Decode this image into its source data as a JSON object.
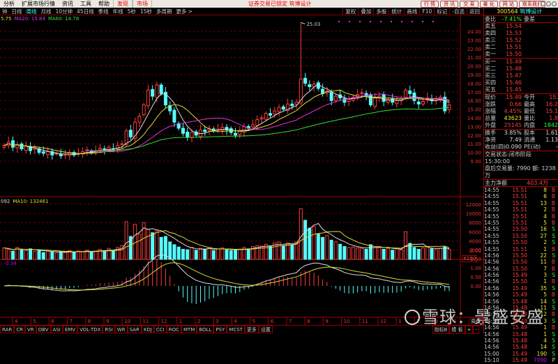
{
  "menu": {
    "items": [
      "分析",
      "扩展市场行情",
      "资讯",
      "工具",
      "帮助"
    ],
    "red_items": [
      "发现",
      "市场"
    ],
    "center": "证券交易已锁定  筑博设计",
    "buttons": [
      "行 情",
      "资 讯",
      "交 易",
      "量 化",
      "网 站",
      "联系我们"
    ]
  },
  "toolbar": {
    "periods": [
      "钟",
      "日线",
      "周线",
      "月线",
      "10分钟",
      "45日线",
      "季线",
      "年线",
      "5秒",
      "15秒",
      "多周期",
      "更多 >"
    ],
    "active": "周线",
    "right": [
      "复权",
      "叠加",
      "多股",
      "统计",
      "画线",
      "F10",
      "标记",
      "-自选",
      "返回"
    ]
  },
  "legends": {
    "price": [
      {
        "text": "5.75",
        "color": "#dddd33"
      },
      {
        "text": "MA20: 15.84",
        "color": "#e030e0"
      },
      {
        "text": "MA60: 14.78",
        "color": "#33dd33"
      }
    ],
    "high_label": "25.03",
    "volume": [
      {
        "text": "092",
        "color": "#ddd"
      },
      {
        "text": "MA10: 132461",
        "color": "#dddd33"
      }
    ],
    "macd": ": -0.34",
    "volume_unit": "X100"
  },
  "axes": {
    "price": [
      "24.00",
      "23.00",
      "22.00",
      "21.00",
      "20.00",
      "19.00",
      "18.00",
      "17.00",
      "16.00",
      "15.00",
      "14.00",
      "13.00",
      "12.00",
      "11.00",
      "10.00",
      "9.00"
    ],
    "volume": [
      "12000",
      "10000",
      "8000",
      "6000",
      "4000",
      "2000"
    ],
    "macd": [
      "2.00",
      "1.50",
      "1.00",
      "0.50",
      "0.00"
    ],
    "months": [
      "4",
      "5",
      "6",
      "7",
      "8",
      "9",
      "10",
      "11",
      "12",
      "1",
      "2",
      "3",
      "4",
      "5",
      "6",
      "7",
      "8",
      "9",
      "10",
      "11",
      "12",
      "1",
      "2",
      "3",
      "4"
    ]
  },
  "chart_data": {
    "type": "candlestick",
    "period": "周线",
    "close": [
      10.8,
      11.2,
      10.6,
      10.9,
      10.4,
      10.7,
      10.2,
      10.5,
      10.0,
      9.9,
      10.1,
      9.7,
      9.9,
      9.6,
      9.8,
      10.0,
      9.7,
      9.9,
      10.1,
      10.3,
      10.0,
      10.2,
      10.5,
      10.3,
      10.6,
      10.4,
      10.8,
      11.0,
      12.5,
      11.8,
      13.5,
      14.2,
      15.5,
      17.2,
      16.5,
      17.8,
      16.8,
      15.5,
      14.8,
      13.5,
      12.8,
      12.2,
      11.8,
      12.3,
      12.0,
      12.6,
      12.4,
      12.8,
      12.5,
      12.7,
      12.9,
      12.6,
      12.3,
      12.0,
      12.5,
      13.0,
      12.8,
      13.2,
      13.8,
      14.0,
      14.5,
      14.3,
      14.8,
      15.2,
      15.0,
      15.6,
      15.4,
      15.8,
      18.5,
      18.0,
      17.6,
      17.9,
      17.4,
      16.8,
      17.1,
      16.0,
      16.5,
      16.3,
      15.8,
      16.2,
      16.4,
      16.7,
      16.9,
      16.6,
      15.5,
      16.3,
      16.5,
      15.9,
      16.1,
      15.8,
      16.0,
      16.2,
      17.2,
      16.8,
      16.0,
      15.6,
      15.9,
      16.3,
      16.0,
      16.2,
      16.4,
      14.8,
      15.49
    ],
    "high_max": 25.03,
    "volume": [
      2500,
      2200,
      1800,
      2600,
      2100,
      1900,
      2300,
      1700,
      2000,
      1500,
      1800,
      1600,
      1400,
      1700,
      1500,
      1900,
      1600,
      1800,
      1700,
      2000,
      1600,
      1800,
      2200,
      1900,
      2400,
      1800,
      2600,
      3000,
      8200,
      5000,
      7600,
      5500,
      8000,
      6500,
      5800,
      6200,
      4800,
      5000,
      3800,
      3200,
      2700,
      2200,
      2100,
      2600,
      2000,
      2400,
      2200,
      2600,
      1900,
      2300,
      2500,
      2100,
      1900,
      2000,
      2200,
      2600,
      2300,
      2800,
      3000,
      2900,
      3300,
      2800,
      3600,
      3800,
      3000,
      3600,
      3200,
      3800,
      11000,
      8500,
      6800,
      7200,
      5500,
      4800,
      5200,
      4200,
      3800,
      3300,
      2800,
      2600,
      2700,
      2500,
      2400,
      2200,
      3200,
      2600,
      2800,
      2200,
      2400,
      2000,
      2300,
      2100,
      6000,
      3500,
      2600,
      2200,
      2500,
      2700,
      2300,
      2100,
      2400,
      2700,
      2200
    ]
  },
  "quote": {
    "code": "300564",
    "name": "筑博设计",
    "weibi_label": "委比",
    "weibi": "-7.41%",
    "weicha_label": "委差",
    "asks": [
      {
        "label": "卖五",
        "price": "15.54"
      },
      {
        "label": "卖四",
        "price": "15.53"
      },
      {
        "label": "卖三",
        "price": "15.52"
      },
      {
        "label": "卖二",
        "price": "15.51"
      },
      {
        "label": "卖一",
        "price": "15.50"
      }
    ],
    "bids": [
      {
        "label": "买一",
        "price": "15.49"
      },
      {
        "label": "买二",
        "price": "15.48"
      },
      {
        "label": "买三",
        "price": "15.47"
      },
      {
        "label": "买四",
        "price": "15.46"
      },
      {
        "label": "买五",
        "price": "15.45"
      }
    ],
    "stats": [
      {
        "l": "现价",
        "v": "15.49",
        "vc": "red",
        "l2": "今开",
        "v2": "15.",
        "v2c": "red"
      },
      {
        "l": "涨跌",
        "v": "0.66",
        "vc": "red",
        "l2": "最高",
        "v2": "16.2",
        "v2c": "red"
      },
      {
        "l": "涨幅",
        "v": "4.45%",
        "vc": "red",
        "l2": "最低",
        "v2": "15.1",
        "v2c": "red"
      },
      {
        "l": "总量",
        "v": "43623",
        "vc": "yel",
        "l2": "量比",
        "v2": "1.8",
        "v2c": "red"
      },
      {
        "l": "外盘",
        "v": "25145",
        "vc": "red",
        "l2": "内盘",
        "v2": "1842",
        "v2c": "grn"
      }
    ],
    "stats2": [
      {
        "l": "换手",
        "v": "3.85%",
        "l2": "股本",
        "v2": "1.61"
      },
      {
        "l": "净资",
        "v": "7.49",
        "l2": "流通",
        "v2": "1.13"
      },
      {
        "l": "收益(四)",
        "v": "-0.090",
        "l2": "PE(动)",
        "v2": "-"
      }
    ],
    "status": "交易状态:闭市阶段 15:30:00",
    "after": "盘后交易量: 7990  额: 1238万",
    "main_label": "主力净额",
    "main_value": "403.4万"
  },
  "trades": [
    [
      "14:55",
      "15.51",
      "8",
      "B"
    ],
    [
      "14:55",
      "15.51",
      "6",
      "B"
    ],
    [
      "14:55",
      "15.51",
      "13",
      "B"
    ],
    [
      "14:55",
      "15.51",
      "2",
      "B"
    ],
    [
      "14:55",
      "15.51",
      "4",
      "B"
    ],
    [
      "14:55",
      "15.51",
      "5",
      "B"
    ],
    [
      "14:55",
      "15.50",
      "16",
      "S"
    ],
    [
      "14:55",
      "15.50",
      "27",
      "S"
    ],
    [
      "14:55",
      "15.50",
      "2",
      "S"
    ],
    [
      "14:55",
      "15.51",
      "1",
      "B"
    ],
    [
      "14:56",
      "15.50",
      "22",
      "S"
    ],
    [
      "14:56",
      "15.50",
      "11",
      "B"
    ],
    [
      "14:56",
      "15.50",
      "7",
      "B"
    ],
    [
      "14:56",
      "15.49",
      "3",
      "S"
    ],
    [
      "14:56",
      "15.50",
      "1",
      "B"
    ],
    [
      "14:56",
      "15.49",
      "35",
      "S"
    ],
    [
      "14:56",
      "15.49",
      "5",
      "B"
    ],
    [
      "14:56",
      "15.48",
      "14",
      "S"
    ],
    [
      "14:56",
      "15.48",
      "11",
      "S"
    ],
    [
      "14:56",
      "15.49",
      "12",
      "B"
    ],
    [
      "14:56",
      "15.49",
      "3",
      "S"
    ],
    [
      "14:56",
      "15.49",
      "1",
      "B"
    ],
    [
      "14:56",
      "15.48",
      "1",
      "S"
    ],
    [
      "14:56",
      "15.48",
      "4",
      "S"
    ],
    [
      "14:56",
      "15.48",
      "14",
      "S"
    ],
    [
      "15:00",
      "15.49",
      "190",
      "S"
    ],
    [
      "15:10",
      "15.49",
      "7990",
      "P"
    ]
  ],
  "bottom": {
    "tabs": [
      "RAR",
      "CR",
      "VR",
      "OBV",
      "ASI",
      "EMV",
      "VOL-TDX",
      "RSI",
      "WR",
      "SAR",
      "KDJ",
      "CCI",
      "ROC",
      "MTM",
      "BOLL",
      "PSY",
      "MCST",
      "更多",
      "设置"
    ],
    "right": [
      "指标B",
      "模 板",
      "+",
      "-"
    ],
    "period": "周线"
  },
  "watermark": "雪球：景盛安盛"
}
